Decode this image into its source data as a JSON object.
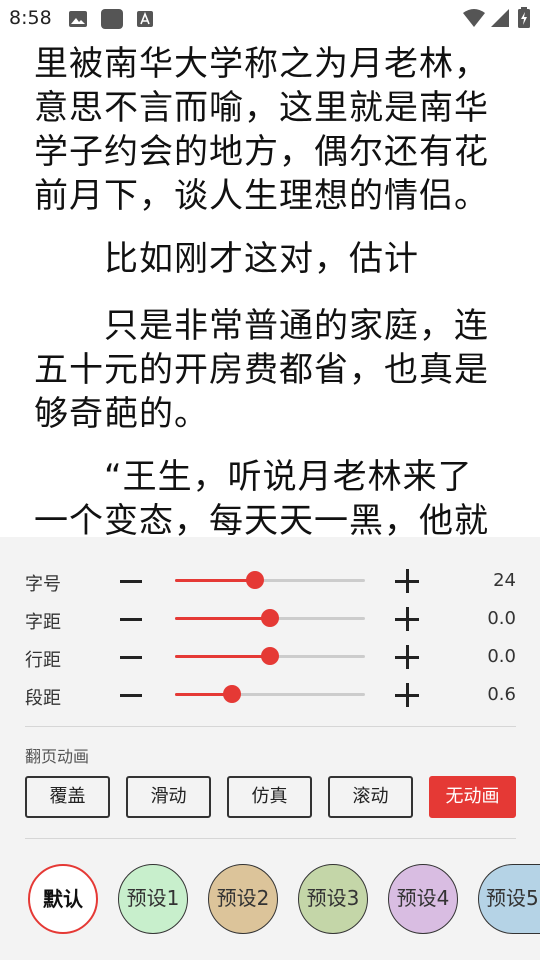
{
  "status_bar": {
    "time": "8:58",
    "left_icons": [
      "image-icon",
      "app-square-icon",
      "font-a-icon"
    ],
    "right_icons": [
      "wifi-icon",
      "signal-icon",
      "battery-charging-icon"
    ]
  },
  "reader": {
    "paragraphs": [
      {
        "lines": [
          "里被南华大学称之为月老林，",
          "意思不言而喻，这里就是南华",
          "学子约会的地方，偶尔还有花",
          "前月下，谈人生理想的情侣。"
        ]
      },
      {
        "lines": [
          "　　比如刚才这对，估计"
        ]
      },
      {
        "lines": [
          "　　只是非常普通的家庭，连",
          "五十元的开房费都省，也真是",
          "够奇葩的。"
        ]
      },
      {
        "lines": [
          "　　“王生，听说月老林来了",
          "一个变态，每天天一黑，他就"
        ]
      }
    ]
  },
  "settings": {
    "rows": [
      {
        "label": "字号",
        "value": "24",
        "level": 0.42
      },
      {
        "label": "字距",
        "value": "0.0",
        "level": 0.5
      },
      {
        "label": "行距",
        "value": "0.0",
        "level": 0.5
      },
      {
        "label": "段距",
        "value": "0.6",
        "level": 0.3
      }
    ],
    "animation_title": "翻页动画",
    "animations": [
      "覆盖",
      "滑动",
      "仿真",
      "滚动",
      "无动画"
    ],
    "active_animation": "无动画",
    "presets": [
      {
        "label": "默认",
        "color": "#ffffff"
      },
      {
        "label": "预设1",
        "color": "#c8efcc"
      },
      {
        "label": "预设2",
        "color": "#dcc49a"
      },
      {
        "label": "预设3",
        "color": "#c4d6a8"
      },
      {
        "label": "预设4",
        "color": "#d9bde2"
      },
      {
        "label": "预设5",
        "color": "#b5d3e6"
      }
    ],
    "accent_color": "#e53935"
  }
}
